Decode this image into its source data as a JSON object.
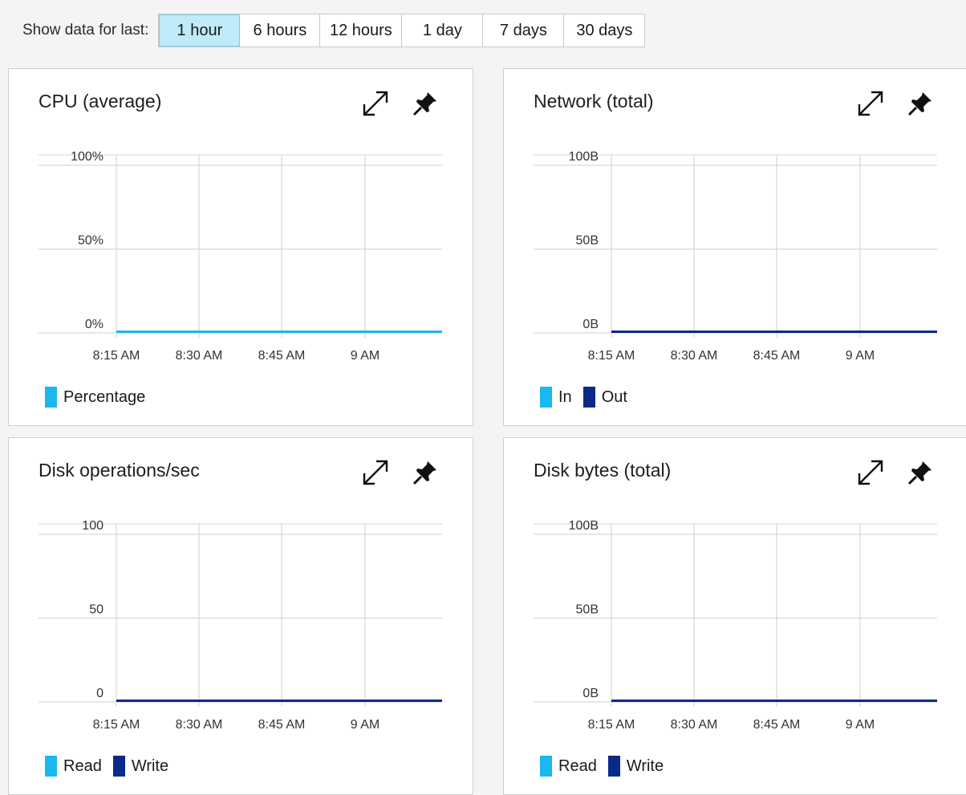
{
  "toolbar": {
    "label": "Show data for last:",
    "ranges": [
      "1 hour",
      "6 hours",
      "12 hours",
      "1 day",
      "7 days",
      "30 days"
    ],
    "selected": "1 hour"
  },
  "colors": {
    "light_blue": "#1ab8ee",
    "dark_blue": "#0a2a8a",
    "active_bg": "#bfeaf8"
  },
  "icons": {
    "expand": "expand-icon",
    "pin": "pin-icon"
  },
  "tiles": [
    {
      "title": "CPU (average)",
      "y_ticks": [
        "100%",
        "50%",
        "0%"
      ],
      "x_ticks": [
        "8:15 AM",
        "8:30 AM",
        "8:45 AM",
        "9 AM"
      ],
      "legend": [
        {
          "name": "Percentage",
          "color": "#1ab8ee"
        }
      ],
      "series_color": "#1ab8ee"
    },
    {
      "title": "Network (total)",
      "y_ticks": [
        "100B",
        "50B",
        "0B"
      ],
      "x_ticks": [
        "8:15 AM",
        "8:30 AM",
        "8:45 AM",
        "9 AM"
      ],
      "legend": [
        {
          "name": "In",
          "color": "#1ab8ee"
        },
        {
          "name": "Out",
          "color": "#0a2a8a"
        }
      ],
      "series_color": "#0a2a8a"
    },
    {
      "title": "Disk operations/sec",
      "y_ticks": [
        "100",
        "50",
        "0"
      ],
      "x_ticks": [
        "8:15 AM",
        "8:30 AM",
        "8:45 AM",
        "9 AM"
      ],
      "legend": [
        {
          "name": "Read",
          "color": "#1ab8ee"
        },
        {
          "name": "Write",
          "color": "#0a2a8a"
        }
      ],
      "series_color": "#0a2a8a"
    },
    {
      "title": "Disk bytes (total)",
      "y_ticks": [
        "100B",
        "50B",
        "0B"
      ],
      "x_ticks": [
        "8:15 AM",
        "8:30 AM",
        "8:45 AM",
        "9 AM"
      ],
      "legend": [
        {
          "name": "Read",
          "color": "#1ab8ee"
        },
        {
          "name": "Write",
          "color": "#0a2a8a"
        }
      ],
      "series_color": "#0a2a8a"
    }
  ],
  "chart_data": [
    {
      "type": "line",
      "title": "CPU (average)",
      "x": [
        "8:15 AM",
        "8:30 AM",
        "8:45 AM",
        "9 AM"
      ],
      "ylim": [
        0,
        100
      ],
      "series": [
        {
          "name": "Percentage",
          "values": [
            0,
            0,
            0,
            0
          ]
        }
      ]
    },
    {
      "type": "line",
      "title": "Network (total)",
      "x": [
        "8:15 AM",
        "8:30 AM",
        "8:45 AM",
        "9 AM"
      ],
      "ylim": [
        0,
        100
      ],
      "series": [
        {
          "name": "In",
          "values": [
            0,
            0,
            0,
            0
          ]
        },
        {
          "name": "Out",
          "values": [
            0,
            0,
            0,
            0
          ]
        }
      ]
    },
    {
      "type": "line",
      "title": "Disk operations/sec",
      "x": [
        "8:15 AM",
        "8:30 AM",
        "8:45 AM",
        "9 AM"
      ],
      "ylim": [
        0,
        100
      ],
      "series": [
        {
          "name": "Read",
          "values": [
            0,
            0,
            0,
            0
          ]
        },
        {
          "name": "Write",
          "values": [
            0,
            0,
            0,
            0
          ]
        }
      ]
    },
    {
      "type": "line",
      "title": "Disk bytes (total)",
      "x": [
        "8:15 AM",
        "8:30 AM",
        "8:45 AM",
        "9 AM"
      ],
      "ylim": [
        0,
        100
      ],
      "series": [
        {
          "name": "Read",
          "values": [
            0,
            0,
            0,
            0
          ]
        },
        {
          "name": "Write",
          "values": [
            0,
            0,
            0,
            0
          ]
        }
      ]
    }
  ]
}
